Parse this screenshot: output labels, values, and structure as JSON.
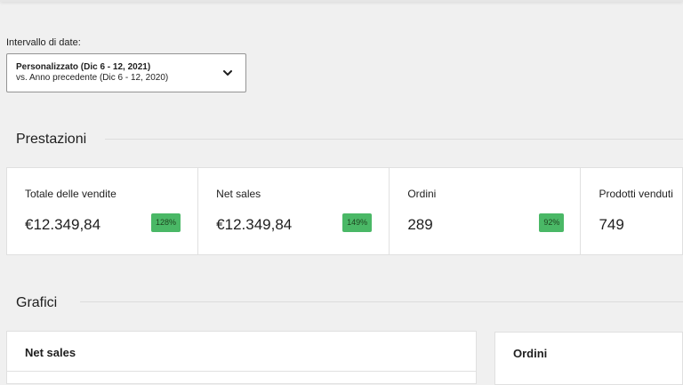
{
  "date_range": {
    "label": "Intervallo di date:",
    "primary": "Personalizzato (Dic 6 - 12, 2021)",
    "secondary": "vs. Anno precedente (Dic 6 - 12, 2020)",
    "icon": "chevron-down-icon"
  },
  "performance": {
    "title": "Prestazioni",
    "cards": [
      {
        "label": "Totale delle vendite",
        "value": "€12.349,84",
        "delta": "128%"
      },
      {
        "label": "Net sales",
        "value": "€12.349,84",
        "delta": "149%"
      },
      {
        "label": "Ordini",
        "value": "289",
        "delta": "92%"
      },
      {
        "label": "Prodotti venduti",
        "value": "749"
      }
    ],
    "badge_color": "#4ab866"
  },
  "charts": {
    "title": "Grafici",
    "cards": [
      {
        "title": "Net sales"
      },
      {
        "title": "Ordini"
      }
    ]
  }
}
